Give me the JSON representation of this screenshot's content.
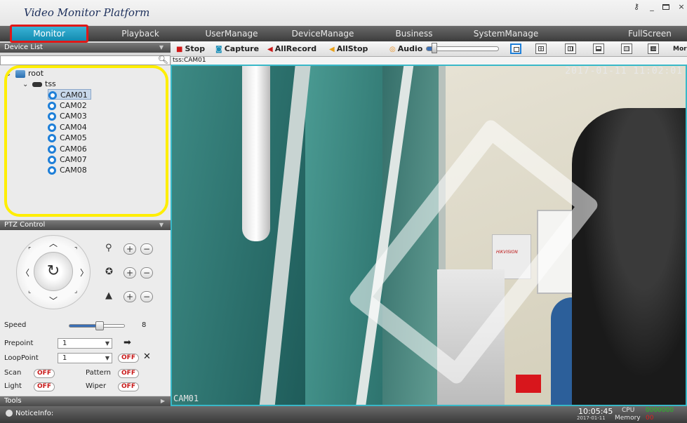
{
  "window": {
    "title": "Video Monitor Platform"
  },
  "nav": {
    "items": [
      {
        "label": "Monitor"
      },
      {
        "label": "Playback"
      },
      {
        "label": "UserManage"
      },
      {
        "label": "DeviceManage"
      },
      {
        "label": "Business"
      },
      {
        "label": "SystemManage"
      },
      {
        "label": "FullScreen"
      }
    ]
  },
  "device_list": {
    "header": "Device List",
    "tree": {
      "root": "root",
      "group": "tss",
      "cameras": [
        "CAM01",
        "CAM02",
        "CAM03",
        "CAM04",
        "CAM05",
        "CAM06",
        "CAM07",
        "CAM08"
      ],
      "selected": "CAM01"
    }
  },
  "ptz": {
    "header": "PTZ Control",
    "speed_label": "Speed",
    "speed_value": "8",
    "speed_level": 0.55,
    "prepoint_label": "Prepoint",
    "prepoint_value": "1",
    "looppoint_label": "LoopPoint",
    "looppoint_value": "1",
    "looppoint_state": "OFF",
    "scan_label": "Scan",
    "scan_state": "OFF",
    "pattern_label": "Pattern",
    "pattern_state": "OFF",
    "light_label": "Light",
    "light_state": "OFF",
    "wiper_label": "Wiper",
    "wiper_state": "OFF"
  },
  "tools": {
    "header": "Tools"
  },
  "toolbar": {
    "stop": "Stop",
    "capture": "Capture",
    "allrecord": "AllRecord",
    "allstop": "AllStop",
    "audio": "Audio",
    "audio_level": 0.08,
    "more": "More"
  },
  "video": {
    "title": "tss:CAM01",
    "timestamp": "2017-01-11 11:02:01",
    "cam_label": "CAM01",
    "brand_text": "HIKVISION"
  },
  "status": {
    "notice": "NoticeInfo:",
    "time": "10:05:45",
    "date": "2017-01-11",
    "cpu_label": "CPU",
    "memory_label": "Memory",
    "cpu_value": "0000000",
    "memory_value": "00",
    "colors": {
      "cpu": "#22c322",
      "memory": "#e02020"
    }
  }
}
